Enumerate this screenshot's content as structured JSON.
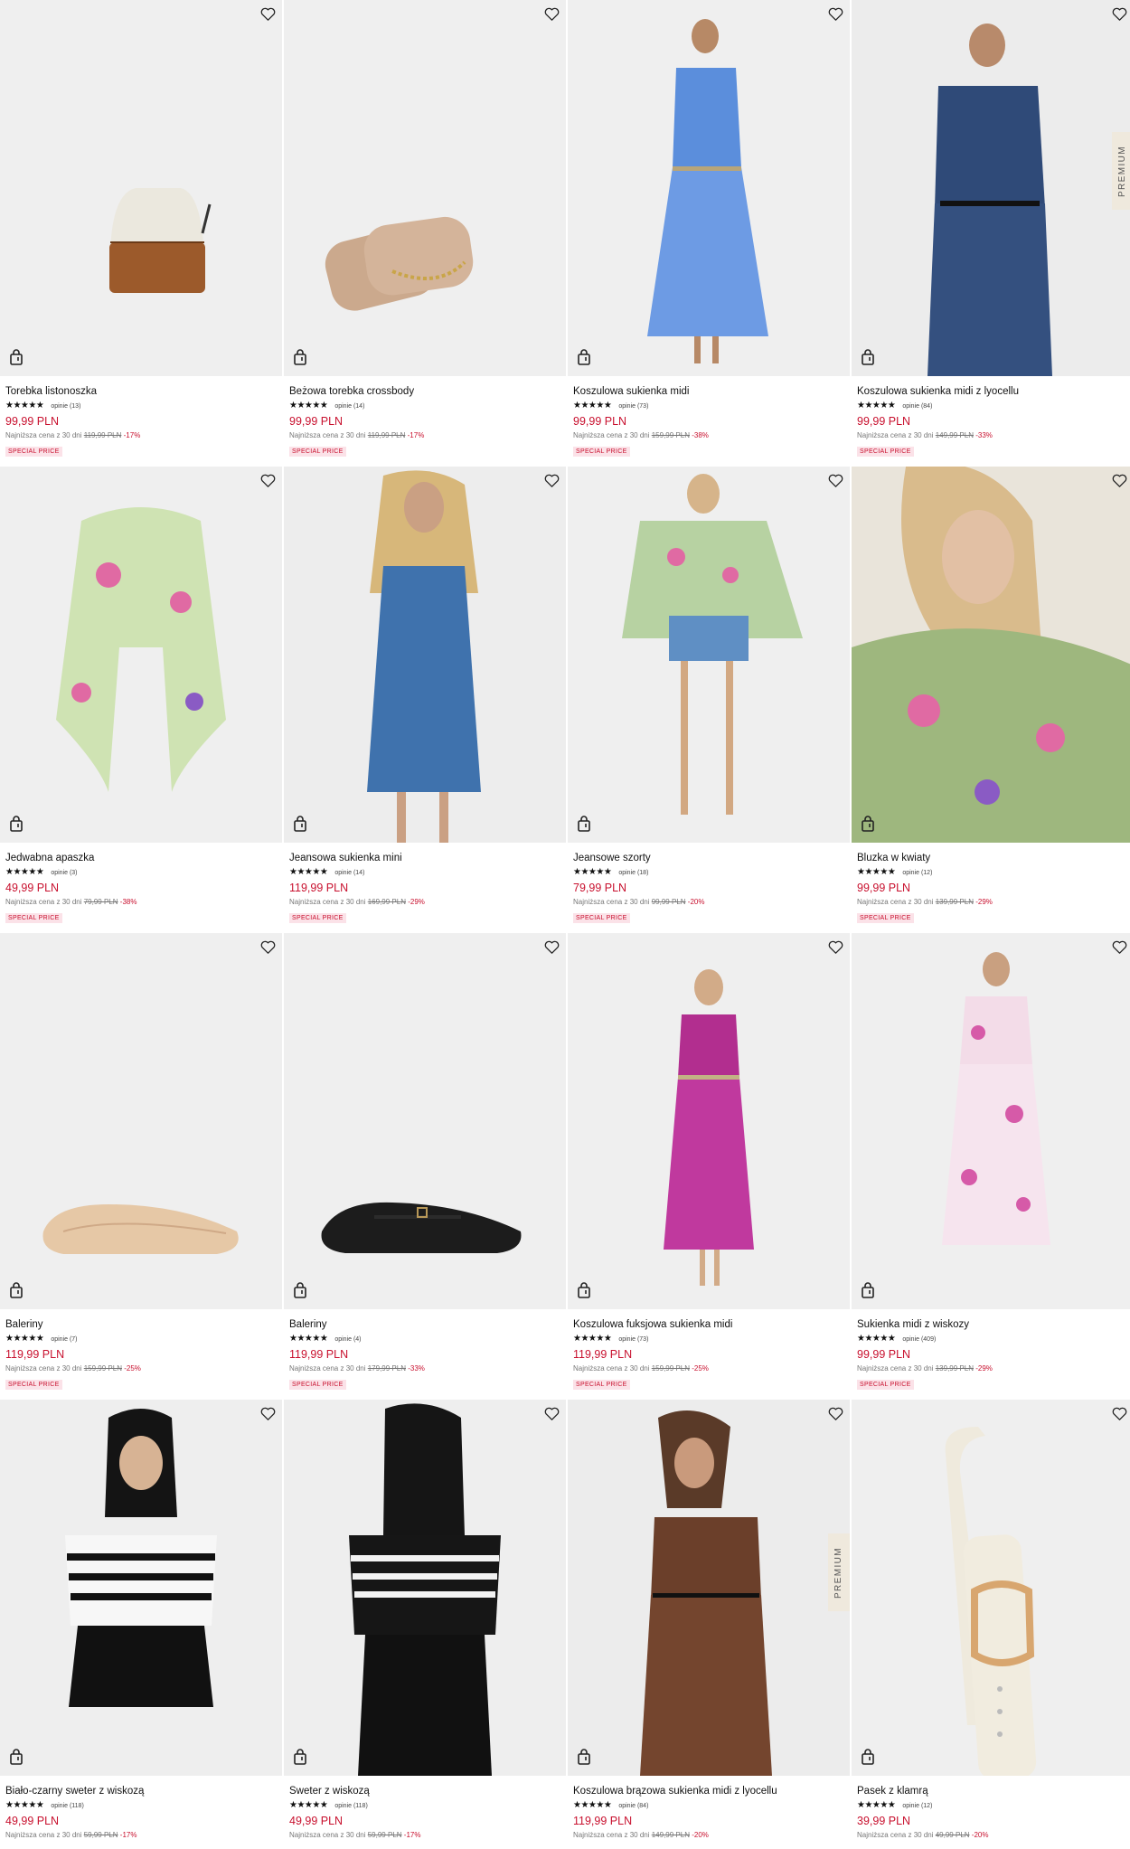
{
  "products": [
    {
      "name": "Torebka listonoszka",
      "stars": "★★★★★",
      "reviews": "opinie (13)",
      "price": "99,99 PLN",
      "lowest_label": "Najniższa cena z 30 dni",
      "old_price": "119,99 PLN",
      "discount": "-17%",
      "badge": "SPECIAL PRICE",
      "premium": ""
    },
    {
      "name": "Beżowa torebka crossbody",
      "stars": "★★★★★",
      "reviews": "opinie (14)",
      "price": "99,99 PLN",
      "lowest_label": "Najniższa cena z 30 dni",
      "old_price": "119,99 PLN",
      "discount": "-17%",
      "badge": "SPECIAL PRICE",
      "premium": ""
    },
    {
      "name": "Koszulowa sukienka midi",
      "stars": "★★★★★",
      "reviews": "opinie (73)",
      "price": "99,99 PLN",
      "lowest_label": "Najniższa cena z 30 dni",
      "old_price": "159,99 PLN",
      "discount": "-38%",
      "badge": "SPECIAL PRICE",
      "premium": ""
    },
    {
      "name": "Koszulowa sukienka midi z lyocellu",
      "stars": "★★★★★",
      "reviews": "opinie (84)",
      "price": "99,99 PLN",
      "lowest_label": "Najniższa cena z 30 dni",
      "old_price": "149,99 PLN",
      "discount": "-33%",
      "badge": "SPECIAL PRICE",
      "premium": "PREMIUM"
    },
    {
      "name": "Jedwabna apaszka",
      "stars": "★★★★★",
      "reviews": "opinie (3)",
      "price": "49,99 PLN",
      "lowest_label": "Najniższa cena z 30 dni",
      "old_price": "79,99 PLN",
      "discount": "-38%",
      "badge": "SPECIAL PRICE",
      "premium": ""
    },
    {
      "name": "Jeansowa sukienka mini",
      "stars": "★★★★★",
      "reviews": "opinie (14)",
      "price": "119,99 PLN",
      "lowest_label": "Najniższa cena z 30 dni",
      "old_price": "169,99 PLN",
      "discount": "-29%",
      "badge": "SPECIAL PRICE",
      "premium": ""
    },
    {
      "name": "Jeansowe szorty",
      "stars": "★★★★★",
      "reviews": "opinie (18)",
      "price": "79,99 PLN",
      "lowest_label": "Najniższa cena z 30 dni",
      "old_price": "99,99 PLN",
      "discount": "-20%",
      "badge": "SPECIAL PRICE",
      "premium": ""
    },
    {
      "name": "Bluzka w kwiaty",
      "stars": "★★★★★",
      "reviews": "opinie (12)",
      "price": "99,99 PLN",
      "lowest_label": "Najniższa cena z 30 dni",
      "old_price": "139,99 PLN",
      "discount": "-29%",
      "badge": "SPECIAL PRICE",
      "premium": ""
    },
    {
      "name": "Baleriny",
      "stars": "★★★★★",
      "reviews": "opinie (7)",
      "price": "119,99 PLN",
      "lowest_label": "Najniższa cena z 30 dni",
      "old_price": "159,99 PLN",
      "discount": "-25%",
      "badge": "SPECIAL PRICE",
      "premium": ""
    },
    {
      "name": "Baleriny",
      "stars": "★★★★★",
      "reviews": "opinie (4)",
      "price": "119,99 PLN",
      "lowest_label": "Najniższa cena z 30 dni",
      "old_price": "179,99 PLN",
      "discount": "-33%",
      "badge": "SPECIAL PRICE",
      "premium": ""
    },
    {
      "name": "Koszulowa fuksjowa sukienka midi",
      "stars": "★★★★★",
      "reviews": "opinie (73)",
      "price": "119,99 PLN",
      "lowest_label": "Najniższa cena z 30 dni",
      "old_price": "159,99 PLN",
      "discount": "-25%",
      "badge": "SPECIAL PRICE",
      "premium": ""
    },
    {
      "name": "Sukienka midi z wiskozy",
      "stars": "★★★★★",
      "reviews": "opinie (409)",
      "price": "99,99 PLN",
      "lowest_label": "Najniższa cena z 30 dni",
      "old_price": "139,99 PLN",
      "discount": "-29%",
      "badge": "SPECIAL PRICE",
      "premium": ""
    },
    {
      "name": "Biało-czarny sweter z wiskozą",
      "stars": "★★★★★",
      "reviews": "opinie (118)",
      "price": "49,99 PLN",
      "lowest_label": "Najniższa cena z 30 dni",
      "old_price": "59,99 PLN",
      "discount": "-17%",
      "badge": "",
      "premium": ""
    },
    {
      "name": "Sweter z wiskozą",
      "stars": "★★★★★",
      "reviews": "opinie (118)",
      "price": "49,99 PLN",
      "lowest_label": "Najniższa cena z 30 dni",
      "old_price": "59,99 PLN",
      "discount": "-17%",
      "badge": "",
      "premium": ""
    },
    {
      "name": "Koszulowa brązowa sukienka midi z lyocellu",
      "stars": "★★★★★",
      "reviews": "opinie (84)",
      "price": "119,99 PLN",
      "lowest_label": "Najniższa cena z 30 dni",
      "old_price": "149,99 PLN",
      "discount": "-20%",
      "badge": "",
      "premium": "PREMIUM"
    },
    {
      "name": "Pasek z klamrą",
      "stars": "★★★★★",
      "reviews": "opinie (12)",
      "price": "39,99 PLN",
      "lowest_label": "Najniższa cena z 30 dni",
      "old_price": "49,99 PLN",
      "discount": "-20%",
      "badge": "",
      "premium": ""
    }
  ],
  "colors": {
    "price": "#c8102e",
    "badge_bg": "#fbe2e8",
    "premium_bg": "#efe9dd",
    "image_bg": "#eeeeee"
  },
  "icons": {
    "favorite": "heart-outline-icon",
    "cart": "shopping-bag-icon"
  }
}
